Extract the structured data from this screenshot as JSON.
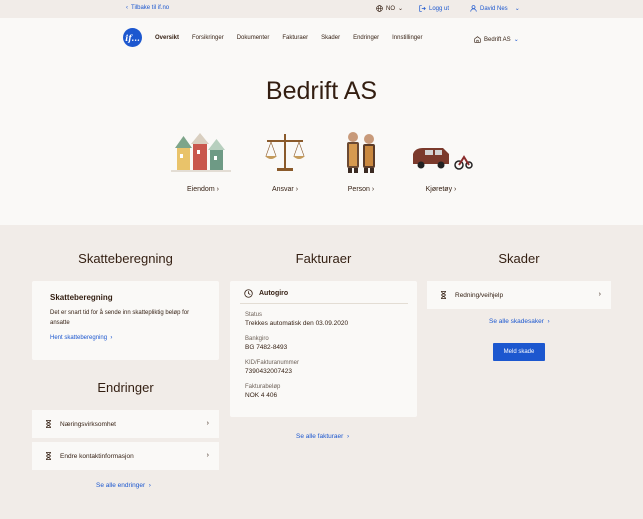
{
  "topbar": {
    "back_label": "Tilbake til if.no",
    "language": "NO",
    "logout_label": "Logg ut",
    "user_name": "David Nes"
  },
  "header": {
    "logo_text": "if...",
    "nav": [
      "Oversikt",
      "Forsikringer",
      "Dokumenter",
      "Fakturaer",
      "Skader",
      "Endringer",
      "Innstillinger"
    ],
    "company_selector": "Bedrift AS",
    "title": "Bedrift AS"
  },
  "categories": [
    "Eiendom",
    "Ansvar",
    "Person",
    "Kjøretøy"
  ],
  "skatteberegning": {
    "section_title": "Skatteberegning",
    "card_title": "Skatteberegning",
    "card_text": "Det er snart tid for å sende inn skattepliktig beløp for ansatte",
    "link": "Hent skatteberegning"
  },
  "endringer": {
    "section_title": "Endringer",
    "items": [
      "Næringsvirksomhet",
      "Endre kontaktinformasjon"
    ],
    "see_all": "Se alle endringer"
  },
  "fakturaer": {
    "section_title": "Fakturaer",
    "card_title": "Autogiro",
    "fields": [
      {
        "label": "Status",
        "value": "Trekkes automatisk den 03.09.2020"
      },
      {
        "label": "Bankgiro",
        "value": "BG 7482-8493"
      },
      {
        "label": "KID/Fakturanummer",
        "value": "7390432007423"
      },
      {
        "label": "Fakturabeløp",
        "value": "NOK 4 406"
      }
    ],
    "see_all": "Se alle fakturaer"
  },
  "skader": {
    "section_title": "Skader",
    "items": [
      "Redning/veihjelp"
    ],
    "see_all": "Se alle skadesaker",
    "button": "Meld skade"
  },
  "colors": {
    "brand_blue": "#1c57cf",
    "text_brown": "#331e11",
    "beige_bg": "#f1ece8",
    "card_bg": "#faf9f7"
  }
}
